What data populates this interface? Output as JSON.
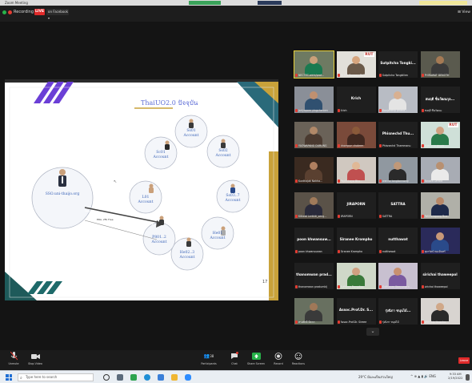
{
  "window": {
    "title": "Zoom Meeting"
  },
  "top_bar": {
    "recording_label": "Recording",
    "live_badge": "LIVE",
    "live_destination": "on Facebook",
    "view_label": "View"
  },
  "slide": {
    "title": "ThaiUO2.0 ปัจจุบัน",
    "page_number": "17",
    "center_node": "SSO.uni-thaijo.org",
    "nodes": [
      {
        "label": "Ss01\nAccount"
      },
      {
        "label": "Ss02\nAccount"
      },
      {
        "label": "Ss03..7\nAccount"
      },
      {
        "label": "He01\nAccount"
      },
      {
        "label": "He02..3\nAccount"
      },
      {
        "label": "P801..2\nAccount"
      },
      {
        "label": "L01\nAccount"
      },
      {
        "label": "Sc01\nAccount"
      }
    ],
    "edge_label": "ERA, 2FA Free"
  },
  "gallery": {
    "tiles": [
      {
        "caption": "NECTEC-wirin/prof...",
        "kind": "photo",
        "active": true,
        "head": "#caa07a",
        "body": "#1a7a50",
        "bg": "#6e7a62"
      },
      {
        "caption": "Sirirat Suwan - RUT...",
        "kind": "photo",
        "head": "#d6a57e",
        "body": "#6b5a4a",
        "bg": "#e2e0da",
        "logo": "RUT"
      },
      {
        "caption": "Sutpitcha Tongkillen",
        "kind": "name",
        "name": "Sutpitcha Tongki..."
      },
      {
        "caption": "PHIRAWAT DENOTH",
        "kind": "photo",
        "head": "#a57a54",
        "body": "#3a3a3a",
        "bg": "#5a5a4e"
      },
      {
        "caption": "jariyaporn yingcheroen",
        "kind": "photo",
        "head": "#c09070",
        "body": "#305070",
        "bg": "#8a8f98"
      },
      {
        "caption": "Krich",
        "kind": "name",
        "name": "Krich"
      },
      {
        "caption": "Kanjanthip phana...",
        "kind": "photo",
        "head": "#d8b091",
        "body": "#e4e4e4",
        "bg": "#b8bcc4"
      },
      {
        "caption": "สมฤดี ชื่นวัฒนะ",
        "kind": "name",
        "name": "สมฤดี ชื่นวัฒนกุล..."
      },
      {
        "caption": "YAOWAPANG DURUNG",
        "kind": "photo",
        "head": "#b08868",
        "body": "#4a3a30",
        "bg": "#6a6258"
      },
      {
        "caption": "chompun chalerm",
        "kind": "photo",
        "head": "#8a5a3a",
        "body": "#402820",
        "bg": "#7a4a3a"
      },
      {
        "caption": "Phisnechd Thammanu",
        "kind": "name",
        "name": "Phisnechd Thu..."
      },
      {
        "caption": "ธมลวรรณ สุขแสง",
        "kind": "photo",
        "head": "#d0a080",
        "body": "#2a7a4a",
        "bg": "#cfe0d8",
        "logo": "RUT"
      },
      {
        "caption": "Kunthajak Nakha...",
        "kind": "photo",
        "head": "#b08060",
        "body": "#5a4030",
        "bg": "#3a2a20"
      },
      {
        "caption": "Papitchaya Bhu...",
        "kind": "photo",
        "head": "#e0b896",
        "body": "#c05050",
        "bg": "#d0c8c0"
      },
      {
        "caption": "wanna tangkonnong",
        "kind": "photo",
        "head": "#c09878",
        "body": "#2a2a2a",
        "bg": "#9098a0"
      },
      {
        "caption": "Tanakit Lertkit",
        "kind": "photo",
        "head": "#b89070",
        "body": "#eaeaea",
        "bg": "#a8acb4"
      },
      {
        "caption": "Kitiwat Lertkiti_seng...",
        "kind": "photo",
        "head": "#a07a5a",
        "body": "#2a2a3a",
        "bg": "#5a5248"
      },
      {
        "caption": "JIRAPORN",
        "kind": "name",
        "name": "JIRAPORN"
      },
      {
        "caption": "SATTRA",
        "kind": "name",
        "name": "SATTRA"
      },
      {
        "caption": "Pattharapong Bua...",
        "kind": "photo",
        "head": "#b88868",
        "body": "#1e2a4a",
        "bg": "#b0b0a8"
      },
      {
        "caption": "poon khwansuwan",
        "kind": "name",
        "name": "poon khwansuw..."
      },
      {
        "caption": "Siranee Krompho",
        "kind": "name",
        "name": "Siranee Krompho"
      },
      {
        "caption": "nutthawat",
        "kind": "name",
        "name": "nutthawat"
      },
      {
        "caption": "สุดารัตน์ ทองอินทร์",
        "kind": "photo",
        "head": "#c89878",
        "body": "#2a4a8a",
        "bg": "#2a2a5a"
      },
      {
        "caption": "thanomwan pradumkij",
        "kind": "name",
        "name": "thanomwan prad..."
      },
      {
        "caption": "Sutheee Pompitoo",
        "kind": "photo",
        "head": "#d0a080",
        "body": "#3a7a3a",
        "bg": "#cfd8c8"
      },
      {
        "caption": "Suthanee Keeyungco...",
        "kind": "photo",
        "head": "#c89070",
        "body": "#7a5aa0",
        "bg": "#c8c0d0"
      },
      {
        "caption": "sirichai thaweepol",
        "kind": "name",
        "name": "sirichai thaweepol"
      },
      {
        "caption": "ทรงศักดิ์ มีลาภ",
        "kind": "photo",
        "head": "#a07858",
        "body": "#3a3a3a",
        "bg": "#687060"
      },
      {
        "caption": "Assoc.Prof.Dr. Sireee",
        "kind": "name",
        "name": "Assoc.Prof.Dr. S..."
      },
      {
        "caption": "รุ่งนิภา ขนุนไม้",
        "kind": "name",
        "name": "รุ่งนิภา ขนุนไม้..."
      },
      {
        "caption": "phinthip tiewcha",
        "kind": "photo",
        "head": "#d0a888",
        "body": "#2a2a2a",
        "bg": "#d8d4d0"
      }
    ],
    "scroll_arrow": "⌄"
  },
  "bottom_bar": {
    "unmute": "Unmute",
    "stop_video": "Stop Video",
    "participants": "Participants",
    "participants_count": "38",
    "chat": "Chat",
    "share_screen": "Share Screen",
    "record": "Record",
    "reactions": "Reactions",
    "leave": "Leave"
  },
  "taskbar": {
    "search_placeholder": "Type here to search",
    "weather": "29°C มีเมฆเป็นส่วนใหญ่",
    "tray": "ENG",
    "time": "9:33 AM",
    "date": "2/19/2022"
  },
  "colors": {
    "accent_purple": "#6b3fd6",
    "accent_gold": "#c9a23a",
    "accent_teal": "#2a6a7a",
    "live_red": "#e02a2a",
    "share_green": "#27b24a"
  }
}
